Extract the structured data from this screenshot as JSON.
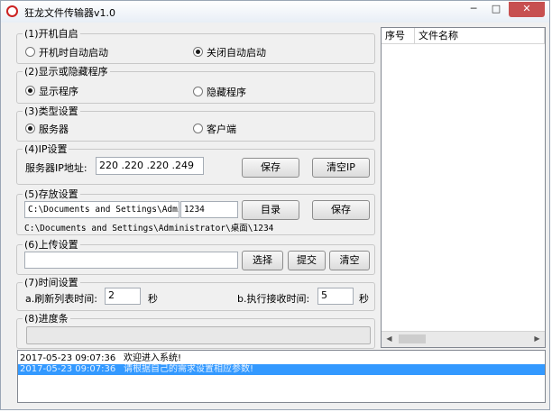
{
  "window": {
    "title": "狂龙文件传输器v1.0",
    "minimize": "─",
    "maximize": "□",
    "close": "✕"
  },
  "groups": {
    "boot": {
      "legend": "(1)开机自启",
      "opt_on": "开机时自动启动",
      "opt_off": "关闭自动启动",
      "selected": "opt_off"
    },
    "visibility": {
      "legend": "(2)显示或隐藏程序",
      "opt_show": "显示程序",
      "opt_hide": "隐藏程序",
      "selected": "opt_show"
    },
    "type": {
      "legend": "(3)类型设置",
      "opt_server": "服务器",
      "opt_client": "客户端",
      "selected": "opt_server"
    },
    "ip": {
      "legend": "(4)IP设置",
      "label": "服务器IP地址:",
      "value": "220 .220 .220 .249",
      "save": "保存",
      "clear": "清空IP"
    },
    "storage": {
      "legend": "(5)存放设置",
      "path": "C:\\Documents and Settings\\Admini",
      "name": "1234",
      "dir_btn": "目录",
      "save_btn": "保存",
      "full_path": "C:\\Documents and Settings\\Administrator\\桌面\\1234"
    },
    "upload": {
      "legend": "(6)上传设置",
      "value": "",
      "choose": "选择",
      "submit": "提交",
      "clear": "清空"
    },
    "time": {
      "legend": "(7)时间设置",
      "refresh_label": "a.刷新列表时间:",
      "refresh_value": "2",
      "refresh_unit": "秒",
      "recv_label": "b.执行接收时间:",
      "recv_value": "5",
      "recv_unit": "秒"
    },
    "progress": {
      "legend": "(8)进度条",
      "value": 0
    }
  },
  "file_list": {
    "columns": [
      "序号",
      "文件名称"
    ],
    "rows": []
  },
  "log": [
    {
      "time": "2017-05-23 09:07:36",
      "message": "欢迎进入系统!",
      "selected": false
    },
    {
      "time": "2017-05-23 09:07:36",
      "message": "请根据自己的需求设置相应参数!",
      "selected": true
    }
  ]
}
